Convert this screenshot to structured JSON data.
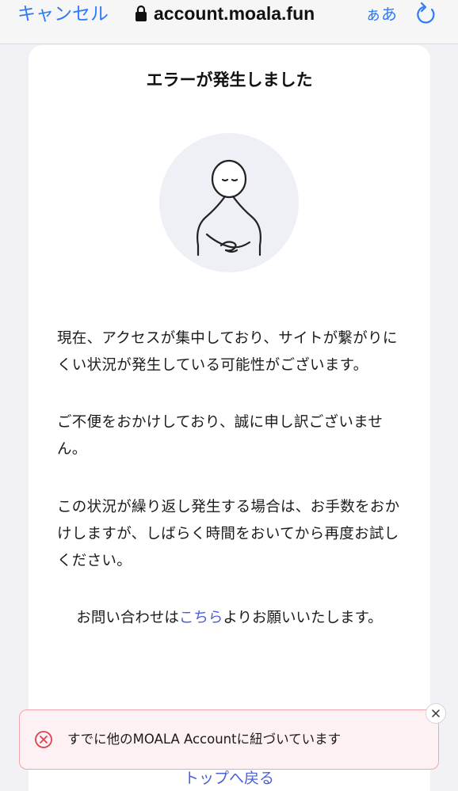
{
  "browser": {
    "cancel_label": "キャンセル",
    "url": "account.moala.fun",
    "text_size_label": "ぁあ",
    "accent_color": "#2f7bf6"
  },
  "page": {
    "title": "エラーが発生しました",
    "paragraphs": [
      "現在、アクセスが集中しており、サイトが繋がりにくい状況が発生している可能性がございます。",
      "ご不便をおかけしており、誠に申し訳ございません。",
      "この状況が繰り返し発生する場合は、お手数をおかけしますが、しばらく時間をおいてから再度お試しください。"
    ],
    "contact": {
      "prefix": "お問い合わせは",
      "link": "こちら",
      "suffix": "よりお願いいたします。"
    },
    "back_link": "トップへ戻る",
    "link_color": "#4a5fd8"
  },
  "toast": {
    "message": "すでに他のMOALA Accountに紐づいています",
    "border_color": "#f3a4ad",
    "icon_color": "#e0414f"
  }
}
